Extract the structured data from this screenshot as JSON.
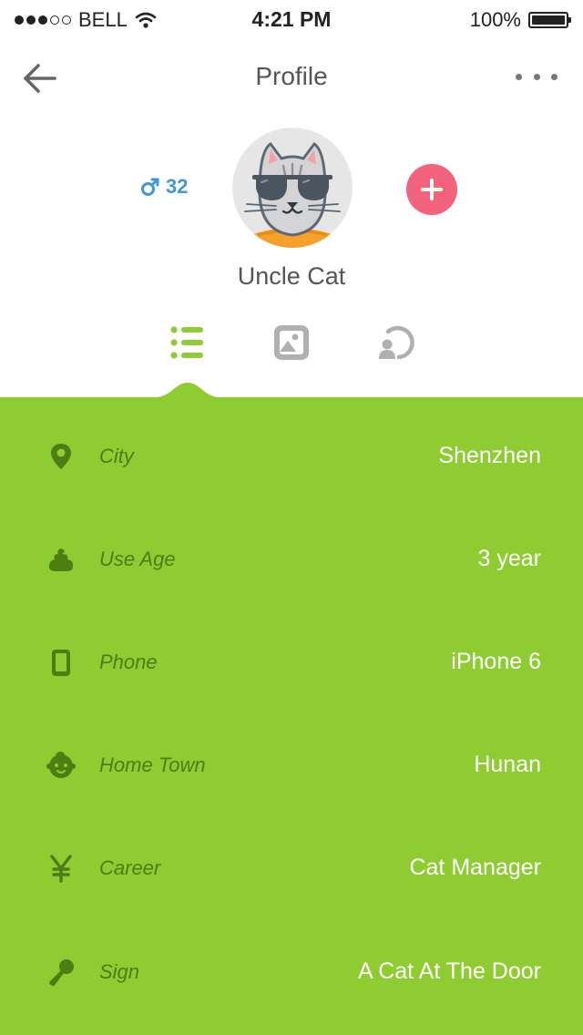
{
  "status_bar": {
    "carrier": "BELL",
    "time": "4:21 PM",
    "battery": "100%",
    "signal_bars": 5,
    "signal_filled": 3
  },
  "nav": {
    "title": "Profile",
    "back_icon": "arrow-left-icon",
    "more_icon": "more-horizontal-icon"
  },
  "profile": {
    "gender_icon": "male-icon",
    "age": "32",
    "name": "Uncle Cat",
    "avatar": "cat-with-sunglasses-avatar",
    "add_icon": "plus-icon"
  },
  "tabs": [
    {
      "icon": "list-icon",
      "active": true
    },
    {
      "icon": "image-icon",
      "active": false
    },
    {
      "icon": "refresh-person-icon",
      "active": false
    }
  ],
  "info": [
    {
      "icon": "location-pin-icon",
      "label": "City",
      "value": "Shenzhen"
    },
    {
      "icon": "poop-icon",
      "label": "Use Age",
      "value": "3 year"
    },
    {
      "icon": "phone-icon",
      "label": "Phone",
      "value": "iPhone 6"
    },
    {
      "icon": "baby-face-icon",
      "label": "Home Town",
      "value": "Hunan"
    },
    {
      "icon": "yen-icon",
      "label": "Career",
      "value": "Cat Manager"
    },
    {
      "icon": "microphone-icon",
      "label": "Sign",
      "value": "A Cat At The Door"
    }
  ],
  "colors": {
    "accent_green": "#8fcc31",
    "label_green": "#4e7d14",
    "add_button": "#f4637d",
    "gender_blue": "#3f97de"
  }
}
